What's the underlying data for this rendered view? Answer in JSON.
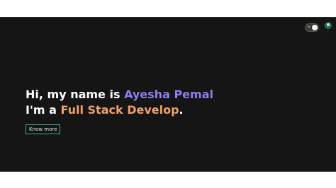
{
  "header": {
    "theme_toggle": {
      "sun_icon": "sun-icon",
      "state": "on"
    },
    "avatar_icon": "avatar-icon",
    "avatar_dots": "· ·"
  },
  "hero": {
    "line1_prefix": "Hi, my name is ",
    "name": "Ayesha Pemal",
    "line2_prefix": "I'm a ",
    "role": "Full Stack Develop",
    "line2_suffix": ".",
    "button_label": "Know more"
  },
  "colors": {
    "background": "#151515",
    "name_accent": "#8c7ff0",
    "role_accent": "#f0a06a",
    "button_border": "#2fb89a"
  }
}
